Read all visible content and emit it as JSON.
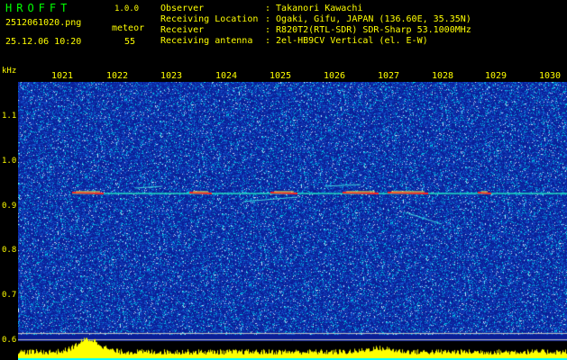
{
  "app": {
    "name": "HROFFT",
    "version": "1.0.0"
  },
  "file": {
    "name": "2512061020.png",
    "datetime": "25.12.06 10:20"
  },
  "meteor": {
    "label": "meteor",
    "count": "55"
  },
  "info": [
    {
      "key": "Observer",
      "value": ": Takanori Kawachi"
    },
    {
      "key": "Receiving Location",
      "value": ": Ogaki, Gifu, JAPAN (136.60E, 35.35N)"
    },
    {
      "key": "Receiver",
      "value": ": R820T2(RTL-SDR) SDR-Sharp 53.1000MHz"
    },
    {
      "key": "Receiving antenna",
      "value": ": 2el-HB9CV Vertical (el. E-W)"
    }
  ],
  "axis": {
    "unit": "kHz",
    "x_ticks": [
      "1021",
      "1022",
      "1023",
      "1024",
      "1025",
      "1026",
      "1027",
      "1028",
      "1029",
      "1030"
    ],
    "y_ticks": [
      "1.1",
      "1.0",
      "0.9",
      "0.8",
      "0.7",
      "0.6"
    ]
  },
  "colors": {
    "background": "#000000",
    "text_yellow": "#ffff00",
    "title_green": "#00ff00",
    "plot_base": "#0a1e96",
    "signal": "#ff2020",
    "level": "#ffff00"
  }
}
